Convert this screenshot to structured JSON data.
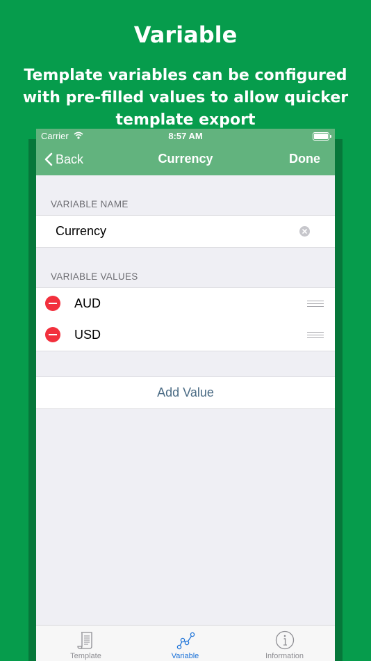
{
  "promo": {
    "headline": "Variable",
    "subline": "Template variables can be configured with pre-filled values to allow quicker template export"
  },
  "status_bar": {
    "carrier": "Carrier",
    "time": "8:57 AM"
  },
  "nav": {
    "back_label": "Back",
    "title": "Currency",
    "done_label": "Done"
  },
  "name_section": {
    "header": "VARIABLE NAME",
    "value": "Currency"
  },
  "values_section": {
    "header": "VARIABLE VALUES",
    "items": [
      {
        "label": "AUD"
      },
      {
        "label": "USD"
      }
    ],
    "add_label": "Add Value"
  },
  "tabs": [
    {
      "label": "Template",
      "icon": "scroll-icon"
    },
    {
      "label": "Variable",
      "icon": "graph-nodes-icon",
      "active": true
    },
    {
      "label": "Information",
      "icon": "info-icon"
    }
  ],
  "colors": {
    "background_green": "#069c4c",
    "nav_green": "#62b37e",
    "delete_red": "#f2303d",
    "tab_active_blue": "#1b72d8",
    "add_value_text": "#4a6b84"
  }
}
